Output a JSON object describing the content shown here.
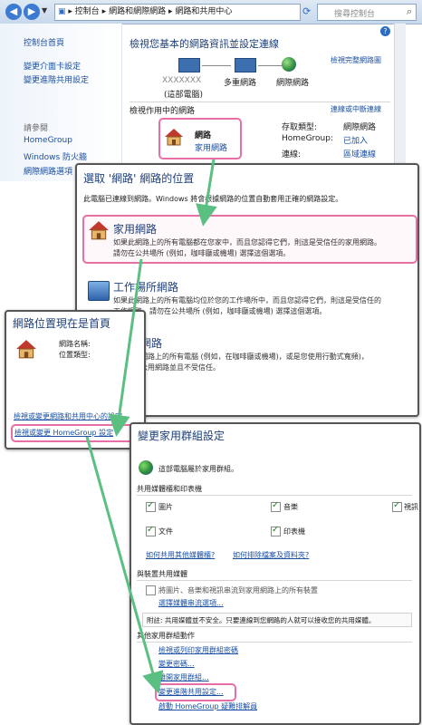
{
  "addressbar": {
    "crumbs": [
      "控制台",
      "網路和網際網路",
      "網路和共用中心"
    ],
    "search_placeholder": "搜尋控制台"
  },
  "sidebar": {
    "home": "控制台首頁",
    "items": [
      "變更介面卡設定",
      "變更進階共用設定"
    ],
    "see_also": "請參閱",
    "see_items": [
      "HomeGroup",
      "Windows 防火牆",
      "網際網路選項"
    ]
  },
  "main": {
    "title": "檢視您基本的網路資訊並設定連線",
    "full_map": "檢視完整網路圖",
    "node_pc_name": "XXXXXXX",
    "node_pc_label": "(這部電腦)",
    "node_multi": "多重網路",
    "node_internet": "網際網路",
    "active_title": "檢視作用中的網路",
    "connect_link": "連線或中斷連線",
    "net_name": "網路",
    "net_type": "家用網路",
    "access_label": "存取類型:",
    "access_value": "網際網路",
    "hg_label": "HomeGroup:",
    "hg_value": "已加入",
    "conn_label": "連線:",
    "conn_value": "區域連線"
  },
  "choose": {
    "title": "選取 '網路' 網路的位置",
    "desc": "此電腦已連線到網路。Windows 將會根據網路的位置自動套用正確的網路設定。",
    "home_title": "家用網路",
    "home_desc_1": "如果此網路上的所有電腦都在您家中，而且您認得它們，則這是受信任的家用網路。",
    "home_desc_2": "請勿在公共場所 (例如，咖啡廳或機場) 選擇這個選項。",
    "work_title": "工作場所網路",
    "work_desc_1": "如果此網路上的所有電腦均位於您的工作場所中，而且您認得它們，則這是受信任的",
    "work_desc_2": "工作網路。請勿在公共場所 (例如，咖啡廳或機場) 選擇這個選項。",
    "public_title": "網路",
    "public_desc_1": "網路上的所有電腦 (例如，在咖啡廳或機場)，或是您使用行動式寬頻)，",
    "public_desc_2": "公用網路並且不受信任。"
  },
  "home_now": {
    "title": "網路位置現在是首頁",
    "name_label": "網路名稱:",
    "type_label": "位置類型:",
    "link1": "檢視或變更網路和共用中心的設定",
    "link2": "檢視或變更 HomeGroup 設定"
  },
  "homegroup": {
    "title": "變更家用群組設定",
    "belongs": "這部電腦屬於家用群組。",
    "share_section": "共用媒體櫃和印表機",
    "checks": [
      {
        "label": "圖片",
        "checked": true
      },
      {
        "label": "音樂",
        "checked": true
      },
      {
        "label": "視訊",
        "checked": true
      },
      {
        "label": "文件",
        "checked": true
      },
      {
        "label": "印表機",
        "checked": true
      }
    ],
    "link_share_other": "如何共用其他媒體櫃?",
    "link_exclude": "如何排除檔案及資料夾?",
    "device_section": "與裝置共用媒體",
    "stream_label": "將圖片、音樂和視訊串流到家用網路上的所有裝置",
    "stream_options": "選擇媒體串流選項...",
    "note": "附註: 共用媒體並不安全。只要連線到您網路的人就可以接收您的共用媒體。",
    "other_section": "其他家用群組動作",
    "actions": [
      "檢視或列印家用群組密碼",
      "變更密碼...",
      "離開家用群組...",
      "變更進階共用設定...",
      "啟動 HomeGroup 疑難排解員"
    ]
  },
  "colors": {
    "highlight": "#e86fa6",
    "arrow": "#5bbf82",
    "link": "#1a4fa3",
    "title": "#1e3f7a"
  }
}
